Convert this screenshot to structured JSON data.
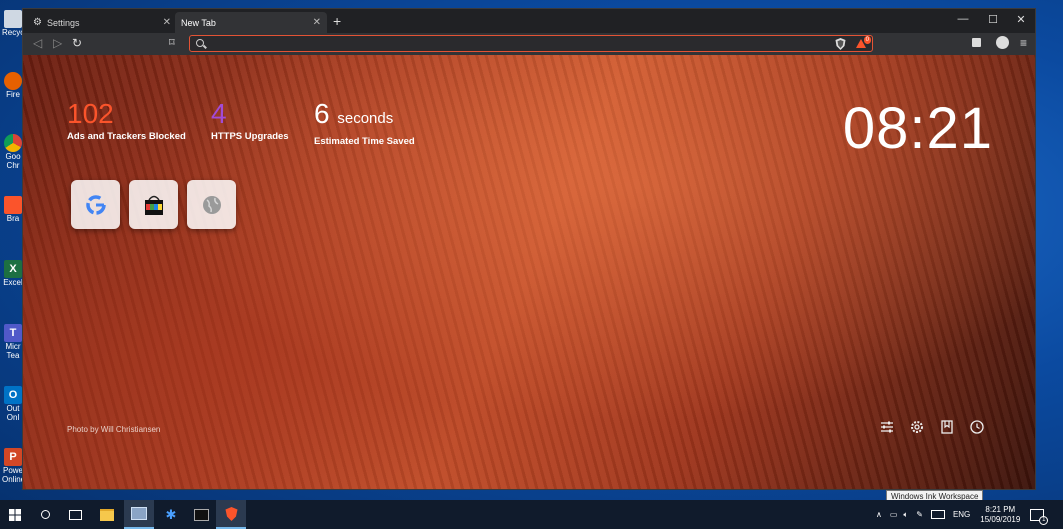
{
  "desktop": {
    "icons": [
      {
        "label": "Recyc",
        "color": "#cfd8e3"
      },
      {
        "label": "Fire",
        "color": "#e66000"
      },
      {
        "label": "Goo",
        "label2": "Chr",
        "color": "#1a73e8"
      },
      {
        "label": "Bra",
        "color": "#fb542b"
      },
      {
        "label": "Excel",
        "color": "#1d6f42"
      },
      {
        "label": "Micr",
        "label2": "Tea",
        "color": "#5059c9"
      },
      {
        "label": "Out",
        "label2": "Onl",
        "color": "#0072c6"
      },
      {
        "label": "Powe",
        "label2": "Online",
        "color": "#d24726"
      }
    ]
  },
  "browser": {
    "tabs": [
      {
        "label": "Settings"
      },
      {
        "label": "New Tab"
      }
    ],
    "new_tab_glyph": "+",
    "window_controls": [
      "—",
      "☐",
      "✕"
    ],
    "address": {
      "value": "",
      "placeholder": ""
    },
    "shields_badge": "0",
    "new_tab_page": {
      "stats": [
        {
          "number": "102",
          "unit": "",
          "caption": "Ads and Trackers Blocked",
          "color": "#fb542b"
        },
        {
          "number": "4",
          "unit": "",
          "caption": "HTTPS Upgrades",
          "color": "#a24bd6"
        },
        {
          "number": "6",
          "unit": "seconds",
          "caption": "Estimated Time Saved",
          "color": "#ffffff"
        }
      ],
      "clock": "08:21",
      "photo_credit": "Photo by Will Christiansen",
      "top_sites": [
        "google-site",
        "shopping-site",
        "globe-site"
      ]
    }
  },
  "taskbar": {
    "tray": {
      "language": "ENG",
      "time": "8:21 PM",
      "date": "15/09/2019",
      "notifications": "1"
    },
    "tooltip": "Windows Ink Workspace"
  }
}
